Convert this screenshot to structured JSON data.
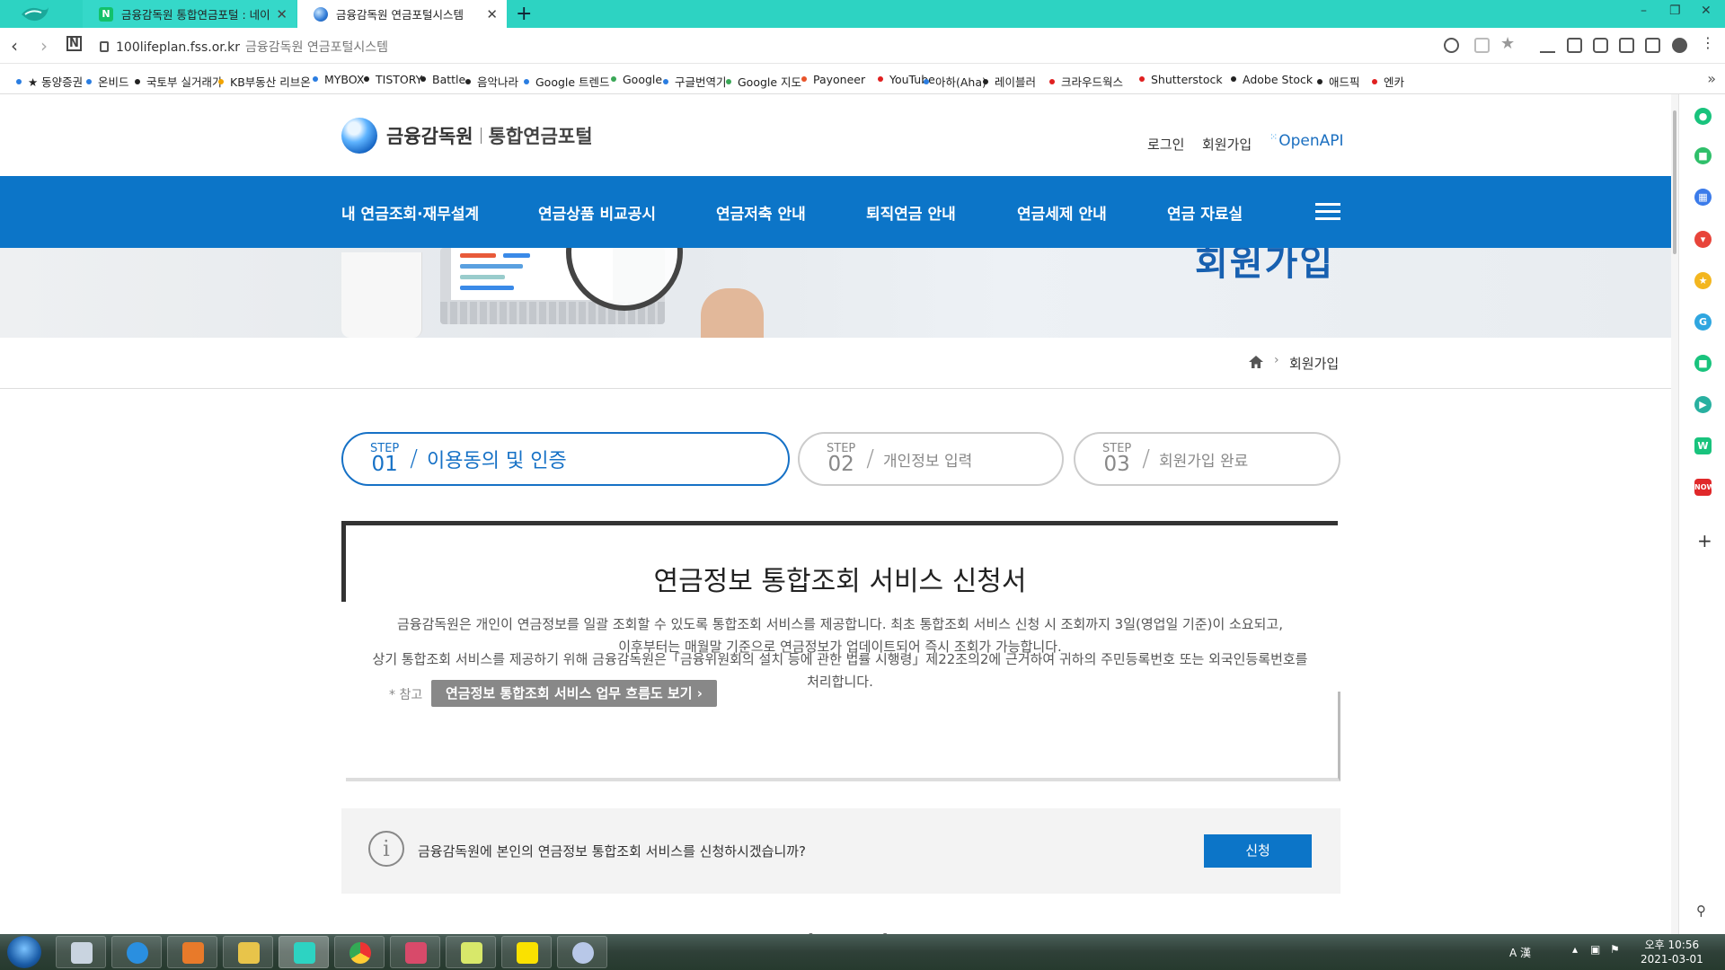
{
  "browser": {
    "tabs": [
      {
        "label": "금융감독원 통합연금포털 : 네이",
        "favicon": "N"
      },
      {
        "label": "금융감독원 연금포털시스템"
      }
    ],
    "new_tab": "+",
    "window_controls": {
      "minimize": "–",
      "restore": "❐",
      "close": "✕"
    },
    "url": "100lifeplan.fss.or.kr",
    "page_title": "금융감독원 연금포털시스템",
    "bookmarks": [
      {
        "label": "★ 동양증권",
        "color": "#2a7de1"
      },
      {
        "label": "온비드",
        "color": "#2a7de1"
      },
      {
        "label": "국토부 실거래가",
        "color": "#222222"
      },
      {
        "label": "KB부동산 리브온",
        "color": "#f2a400"
      },
      {
        "label": "MYBOX",
        "color": "#2a7de1"
      },
      {
        "label": "TISTORY",
        "color": "#222222"
      },
      {
        "label": "Battle",
        "color": "#222222"
      },
      {
        "label": "음악나라",
        "color": "#222222"
      },
      {
        "label": "Google 트렌드",
        "color": "#2a7de1"
      },
      {
        "label": "Google",
        "color": "#3aa757"
      },
      {
        "label": "구글번역기",
        "color": "#2a7de1"
      },
      {
        "label": "Google 지도",
        "color": "#3aa757"
      },
      {
        "label": "Payoneer",
        "color": "#e8542a"
      },
      {
        "label": "YouTube",
        "color": "#e02020"
      },
      {
        "label": "아하(Aha)",
        "color": "#2a7de1"
      },
      {
        "label": "레이블러",
        "color": "#222222"
      },
      {
        "label": "크라우드웍스",
        "color": "#e02020"
      },
      {
        "label": "Shutterstock",
        "color": "#e02020"
      },
      {
        "label": "Adobe Stock",
        "color": "#222222"
      },
      {
        "label": "애드픽",
        "color": "#222222"
      },
      {
        "label": "엔카",
        "color": "#e02020"
      }
    ],
    "bookmarks_more": "»"
  },
  "site": {
    "brand": {
      "org": "금융감독원",
      "portal": "통합연금포털"
    },
    "util_links": {
      "login": "로그인",
      "signup": "회원가입",
      "openapi": "OpenAPI"
    },
    "gnb": [
      "내 연금조회·재무설계",
      "연금상품 비교공시",
      "연금저축 안내",
      "퇴직연금 안내",
      "연금세제 안내",
      "연금 자료실"
    ],
    "banner_title": "회원가입",
    "breadcrumb": {
      "current": "회원가입"
    },
    "steps": [
      {
        "step": "STEP",
        "num": "01",
        "title": "이용동의 및 인증",
        "active": true
      },
      {
        "step": "STEP",
        "num": "02",
        "title": "개인정보 입력",
        "active": false
      },
      {
        "step": "STEP",
        "num": "03",
        "title": "회원가입 완료",
        "active": false
      }
    ],
    "form": {
      "title": "연금정보 통합조회 서비스 신청서",
      "p1_line1": "금융감독원은 개인이 연금정보를 일괄 조회할 수 있도록 통합조회 서비스를 제공합니다. 최초 통합조회 서비스 신청 시 조회까지 3일(영업일 기준)이 소요되고,",
      "p1_line2": "이후부터는 매월말 기준으로 연금정보가 업데이트되어 즉시 조회가 가능합니다.",
      "p2_line1": "상기 통합조회 서비스를 제공하기 위해 금융감독원은「금융위원회의 설치 등에 관한 법률 시행령」제22조의2에 근거하여 귀하의 주민등록번호 또는 외국인등록번호를",
      "p2_line2": "처리합니다.",
      "ref_label": "* 참고",
      "flow_button": "연금정보 통합조회 서비스 업무 흐름도 보기 ›"
    },
    "apply": {
      "question": "금융감독원에 본인의 연금정보 통합조회 서비스를 신청하시겠습니까?",
      "button": "신청"
    },
    "next_heading": "이용동의",
    "colors": {
      "primary": "#0c75c8",
      "active_step": "#1671c6"
    }
  },
  "taskbar": {
    "tray_ime": "A 漢",
    "clock_time": "오후 10:56",
    "clock_date": "2021-03-01"
  }
}
